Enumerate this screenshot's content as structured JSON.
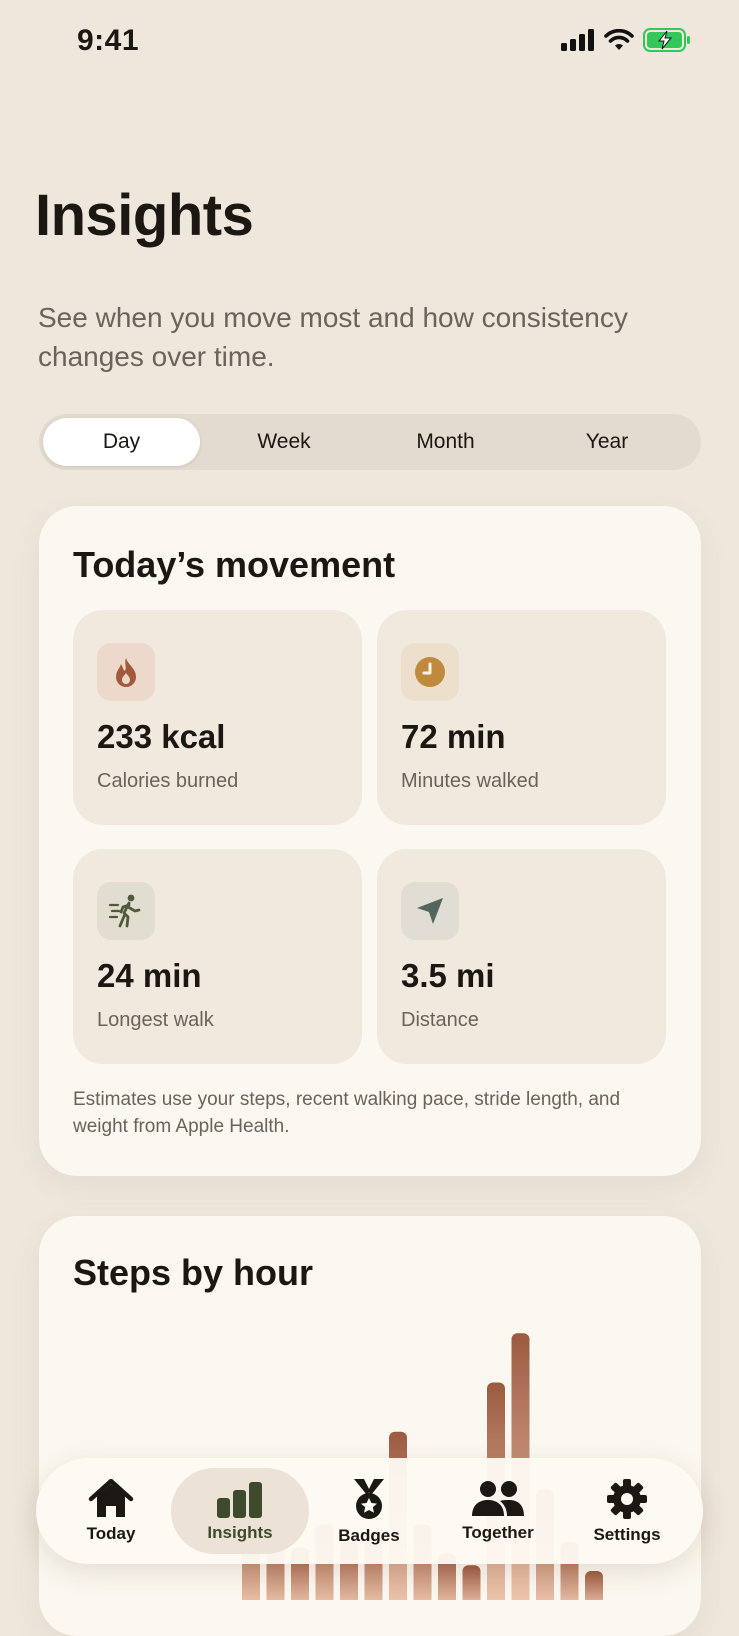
{
  "status_bar": {
    "time": "9:41",
    "icons": [
      "cellular-signal-icon",
      "wifi-icon",
      "battery-charging-icon"
    ]
  },
  "page": {
    "title": "Insights",
    "subtitle": "See when you move most and how consistency changes over time."
  },
  "range_selector": {
    "selected": "Day",
    "options": [
      "Day",
      "Week",
      "Month",
      "Year"
    ]
  },
  "movement_card": {
    "title": "Today’s movement",
    "metrics": [
      {
        "value": "233 kcal",
        "label": "Calories burned",
        "icon": "flame-icon",
        "color": "#a35a3c"
      },
      {
        "value": "72 min",
        "label": "Minutes walked",
        "icon": "clock-icon",
        "color": "#c08a3e"
      },
      {
        "value": "24 min",
        "label": "Longest walk",
        "icon": "walking-figure-icon",
        "color": "#4f5a3c"
      },
      {
        "value": "3.5 mi",
        "label": "Distance",
        "icon": "location-arrow-icon",
        "color": "#52655f"
      }
    ],
    "footnote": "Estimates use your steps, recent walking pace, stride length, and weight from Apple Health."
  },
  "steps_card": {
    "title": "Steps by hour"
  },
  "chart_data": {
    "type": "bar",
    "title": "Steps by hour",
    "note": "Only the upper portion of the chart is visible; unlabeled relative heights.",
    "values": [
      0.3,
      0.22,
      0.18,
      0.26,
      0.2,
      0.24,
      0.58,
      0.26,
      0.16,
      0.12,
      0.75,
      0.92,
      0.38,
      0.2,
      0.1
    ],
    "ylim": [
      0,
      1
    ],
    "colors": {
      "bar_top": "#9c5a40",
      "bar_bottom": "#efc9b0"
    }
  },
  "tab_bar": {
    "active": "Insights",
    "tabs": [
      {
        "label": "Today",
        "icon": "house-icon"
      },
      {
        "label": "Insights",
        "icon": "bar-chart-icon"
      },
      {
        "label": "Badges",
        "icon": "medal-icon"
      },
      {
        "label": "Together",
        "icon": "people-icon"
      },
      {
        "label": "Settings",
        "icon": "gear-icon"
      }
    ]
  },
  "colors": {
    "background": "#efe7dc",
    "card": "#fbf8f1",
    "accent_green": "#3d4a2b",
    "text_secondary": "#6b6259"
  }
}
